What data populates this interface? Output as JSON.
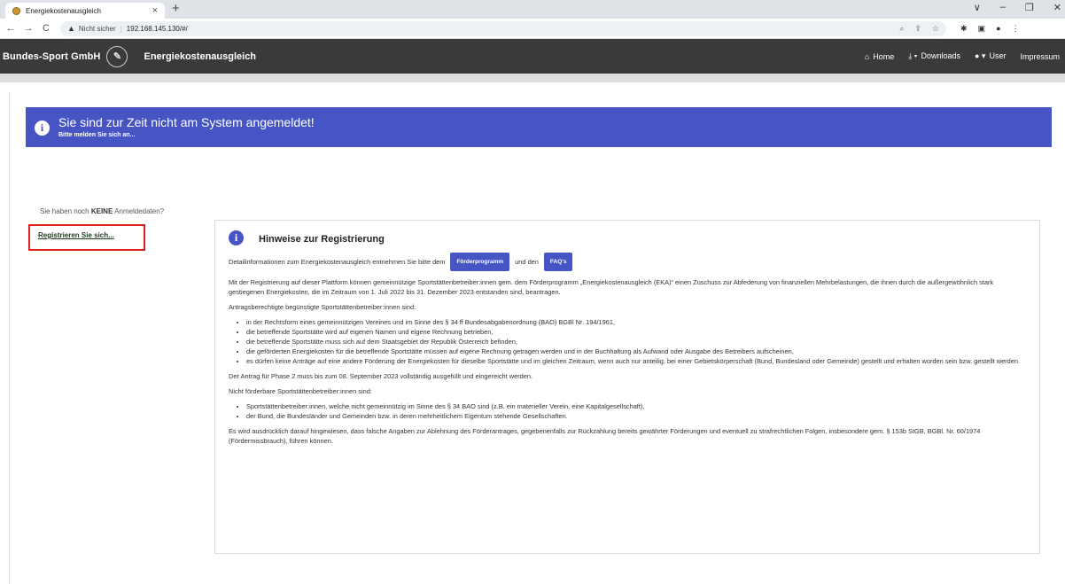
{
  "browser": {
    "tab_title": "Energiekostenausgleich",
    "tab_close": "×",
    "new_tab": "+",
    "window_controls": [
      "∨",
      "–",
      "❐",
      "✕"
    ],
    "security_label": "Nicht sicher",
    "url": "192.168.145.130/#/"
  },
  "navbar": {
    "brand": "Bundes-Sport GmbH",
    "app_title": "Energiekostenausgleich",
    "items": [
      {
        "label": "Home",
        "icon": "home-icon"
      },
      {
        "label": "Downloads",
        "icon": "download-icon"
      },
      {
        "label": "User",
        "icon": "user-icon"
      },
      {
        "label": "Impressum",
        "icon": ""
      }
    ]
  },
  "alert": {
    "title": "Sie sind zur Zeit nicht am System angemeldet!",
    "subtitle": "Bitte melden Sie sich an..."
  },
  "sidebar": {
    "no_account_prefix": "Sie haben noch ",
    "no_account_bold": "KEINE",
    "no_account_suffix": " Anmeldedaten?",
    "register_link": "Registrieren Sie sich..."
  },
  "card": {
    "title": "Hinweise zur Registrierung",
    "intro_prefix": "Detailinformationen zum Energiekostenausgleich entnehmen Sie bitte dem",
    "button_program": "Förderprogramm",
    "intro_mid": "und den",
    "button_faq": "FAQ's",
    "para1": "Mit der Registrierung auf dieser Plattform können gemeinnützige Sportstättenbetreiber:innen gem. dem Förderprogramm „Energiekostenausgleich (EKA)“ einen Zuschuss zur Abfederung von finanziellen Mehrbelastungen, die ihnen durch die außergewöhnlich stark gestiegenen Energiekosten, die im Zeitraum von 1. Juli 2022 bis 31. Dezember 2023 entstanden sind, beantragen.",
    "eligible_heading": "Antragsberechtigte begünstigte Sportstättenbetreiber:innen sind:",
    "eligible_items": [
      "in der Rechtsform eines gemeinnützigen Vereines und im Sinne des § 34 ff Bundesabgabenordnung (BAO) BGBl Nr. 194/1961,",
      "die betreffende Sportstätte wird auf eigenen Namen und eigene Rechnung betrieben,",
      "die betreffende Sportstätte muss sich auf dem Staatsgebiet der Republik Österreich befinden,",
      "die geförderten Energiekosten für die betreffende Sportstätte müssen auf eigene Rechnung getragen werden und in der Buchhaltung als Aufwand oder Ausgabe des Betreibers aufscheinen,",
      "es dürfen keine Anträge auf eine andere Förderung der Energiekosten für dieselbe Sportstätte und im gleichen Zeitraum, wenn auch nur anteilig, bei einer Gebietskörperschaft (Bund, Bundesland oder Gemeinde) gestellt und erhalten worden sein bzw. gestellt werden."
    ],
    "deadline": "Der Antrag für Phase 2 muss bis zum 08. September 2023 vollständig ausgefüllt und eingereicht werden.",
    "ineligible_heading": "Nicht förderbare Sportstättenbetreiber:innen sind:",
    "ineligible_items": [
      "Sportstättenbetreiber:innen, welche nicht gemeinnützig im Sinne des § 34 BAO sind (z.B. ein materieller Verein, eine Kapitalgesellschaft),",
      "der Bund, die Bundesländer und Gemeinden bzw. in deren mehrheitlichem Eigentum stehende Gesellschaften."
    ],
    "warning": "Es wird ausdrücklich darauf hingewiesen, dass falsche Angaben zur Ablehnung des Förderantrages, gegebenenfalls zur Rückzahlung bereits gewährter Förderungen und eventuell zu strafrechtlichen Folgen, insbesondere gem. § 153b StGB, BGBl. Nr. 60/1974 (Fördermissbrauch), führen können."
  },
  "colors": {
    "primary": "#4755c4",
    "navbar": "#3a3a3a",
    "highlight": "#e02020"
  }
}
